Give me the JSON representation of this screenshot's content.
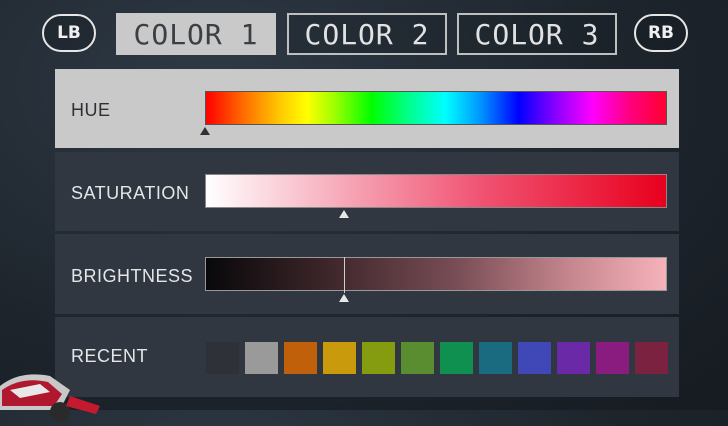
{
  "header": {
    "lb_label": "LB",
    "rb_label": "RB",
    "tabs": [
      {
        "label": "COLOR 1",
        "active": true
      },
      {
        "label": "COLOR 2",
        "active": false
      },
      {
        "label": "COLOR 3",
        "active": false
      }
    ]
  },
  "hue": {
    "label": "HUE",
    "value_fraction": 0.0
  },
  "saturation": {
    "label": "SATURATION",
    "value_fraction": 0.3
  },
  "brightness": {
    "label": "BRIGHTNESS",
    "value_fraction": 0.3
  },
  "recent": {
    "label": "RECENT",
    "swatches": [
      "#2e3238",
      "#9a9a9a",
      "#c0600a",
      "#c89a0c",
      "#869c10",
      "#5a8c30",
      "#109050",
      "#1a6a80",
      "#4048b8",
      "#6a2aa8",
      "#8a1c80",
      "#7a2240"
    ]
  },
  "colors": {
    "active_tab_bg": "#c9c9c9",
    "panel_bg": "#303740"
  }
}
